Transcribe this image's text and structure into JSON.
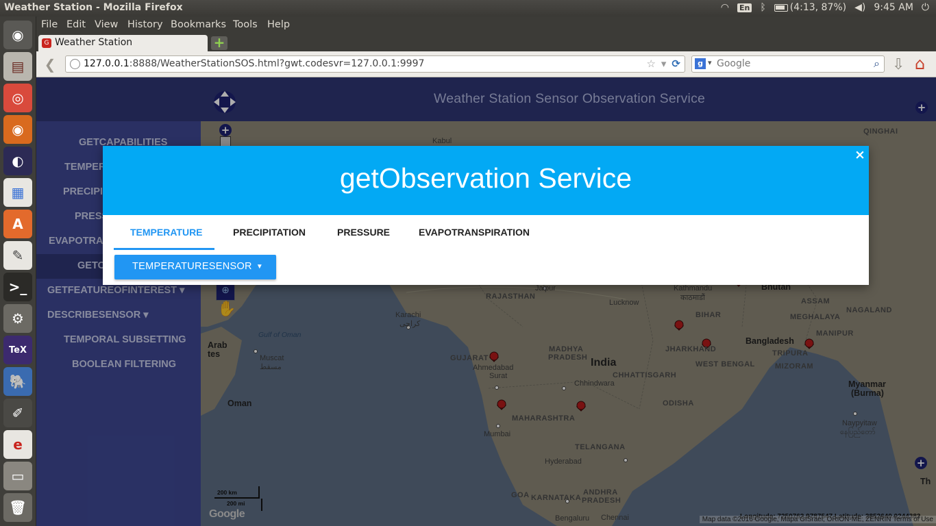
{
  "os": {
    "window_title": "Weather Station - Mozilla Firefox",
    "lang": "En",
    "battery": "(4:13, 87%)",
    "clock": "9:45 AM"
  },
  "launcher": {
    "icons": [
      "ubuntu-dash-icon",
      "files-icon",
      "chrome-icon",
      "firefox-icon",
      "eclipse-icon",
      "libreoffice-impress-icon",
      "software-center-icon",
      "text-editor-icon",
      "terminal-icon",
      "settings-penguin-icon",
      "texmaker-icon",
      "pgadmin-icon",
      "paint-icon",
      "ebook-icon",
      "drive-icon",
      "trash-icon"
    ]
  },
  "browser": {
    "menu": [
      "File",
      "Edit",
      "View",
      "History",
      "Bookmarks",
      "Tools",
      "Help"
    ],
    "tab_title": "Weather Station",
    "url_host": "127.0.0.1",
    "url_rest": ":8888/WeatherStationSOS.html?gwt.codesvr=127.0.0.1:9997",
    "search_placeholder": "Google"
  },
  "page": {
    "header_title": "Weather Station Sensor Observation Service",
    "sidebar": [
      {
        "label": "GETCAPABILITIES"
      },
      {
        "label": "TEMPER"
      },
      {
        "label": "PRECIPIT"
      },
      {
        "label": "PRESS"
      },
      {
        "label": "EVAPOTRAN"
      },
      {
        "label": "GETO"
      },
      {
        "label": "GETFEATUREOFINTEREST ▾"
      },
      {
        "label": "DESCRIBESENSOR ▾"
      },
      {
        "label": "TEMPORAL SUBSETTING"
      },
      {
        "label": "BOOLEAN FILTERING"
      }
    ]
  },
  "map": {
    "labels": {
      "kabul": "Kabul",
      "qinghai": "QINGHAI",
      "jaipur": "Jaipur",
      "rajasthan": "RAJASTHAN",
      "kathmandu": "Kathmandu",
      "kathmandu_native": "काठमाडौं",
      "bhutan": "Bhutan",
      "lucknow": "Lucknow",
      "assam": "ASSAM",
      "nagaland": "NAGALAND",
      "karachi": "Karachi",
      "karachi_native": "کراچی",
      "bihar": "BIHAR",
      "meghalaya": "MEGHALAYA",
      "gulf_of_oman": "Gulf of Oman",
      "jharkhand": "JHARKHAND",
      "bangladesh": "Bangladesh",
      "manipur": "MANIPUR",
      "arab": "Arab",
      "states": "tes",
      "muscat": "Muscat",
      "muscat_native": "مسقط",
      "gujarat": "GUJARAT",
      "ahmedabad": "Ahmedabad",
      "madhya": "MADHYA",
      "pradesh": "PRADESH",
      "india": "India",
      "chhattisgarh": "CHHATTISGARH",
      "west_bengal": "WEST BENGAL",
      "tripura": "TRIPURA",
      "mizoram": "MIZORAM",
      "chhindwara": "Chhindwara",
      "myanmar": "Myanmar",
      "burma": "(Burma)",
      "surat": "Surat",
      "oman": "Oman",
      "odisha": "ODISHA",
      "maharashtra": "MAHARASHTRA",
      "naypyitaw": "Naypyitaw",
      "naypyitaw_native": "နေပြည်တော်",
      "mumbai": "Mumbai",
      "telangana": "TELANGANA",
      "hyderabad": "Hyderabad",
      "karnataka": "KARNATAKA",
      "andhra": "ANDHRA",
      "pradesh2": "PRADESH",
      "goa": "GOA",
      "bengaluru": "Bengaluru",
      "chennai": "Chennai",
      "th": "Th"
    },
    "scale_km": "200 km",
    "scale_mi": "200 mi",
    "google": "Google",
    "attribution": "Map data ©2016 Google, Mapa GISrael, ORION-ME, ZENRIN   Terms of Use",
    "coordinates": "Longitude: 7250762.9787547 Latitude: 2852640.0244383"
  },
  "modal": {
    "title": "getObservation Service",
    "close": "×",
    "tabs": [
      "TEMPERATURE",
      "PRECIPITATION",
      "PRESSURE",
      "EVAPOTRANSPIRATION"
    ],
    "active_tab": 0,
    "sensor_button": "TEMPERATURESENSOR",
    "accent": "#03a9f4",
    "button_color": "#2196f3"
  }
}
